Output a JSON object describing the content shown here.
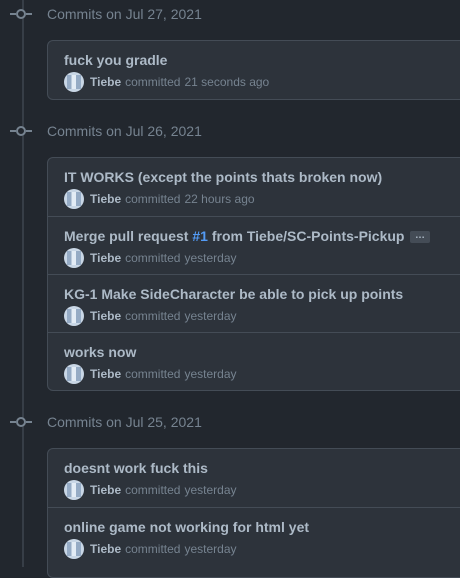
{
  "groups": [
    {
      "title": "Commits on Jul 27, 2021",
      "commits": [
        {
          "message": "fuck you gradle",
          "author": "Tiebe",
          "verb": "committed",
          "time": "21 seconds ago"
        }
      ]
    },
    {
      "title": "Commits on Jul 26, 2021",
      "commits": [
        {
          "message": "IT WORKS (except the points thats broken now)",
          "author": "Tiebe",
          "verb": "committed",
          "time": "22 hours ago"
        },
        {
          "message_prefix": "Merge pull request ",
          "pr_link": "#1",
          "message_suffix": " from Tiebe/SC-Points-Pickup",
          "ellipsis": "…",
          "author": "Tiebe",
          "verb": "committed",
          "time": "yesterday"
        },
        {
          "message": "KG-1 Make SideCharacter be able to pick up points",
          "author": "Tiebe",
          "verb": "committed",
          "time": "yesterday"
        },
        {
          "message": "works now",
          "author": "Tiebe",
          "verb": "committed",
          "time": "yesterday"
        }
      ]
    },
    {
      "title": "Commits on Jul 25, 2021",
      "commits": [
        {
          "message": "doesnt work fuck this",
          "author": "Tiebe",
          "verb": "committed",
          "time": "yesterday"
        },
        {
          "message": "online game not working for html yet",
          "author": "Tiebe",
          "verb": "committed",
          "time": "yesterday"
        }
      ]
    }
  ],
  "colors": {
    "background": "#22272e",
    "box": "#2d333b",
    "border": "#444c56",
    "muted": "#768390",
    "text": "#adbac7",
    "link": "#539bf5"
  },
  "icons": {
    "commit_node": "git-commit-icon",
    "avatar": "user-avatar"
  }
}
